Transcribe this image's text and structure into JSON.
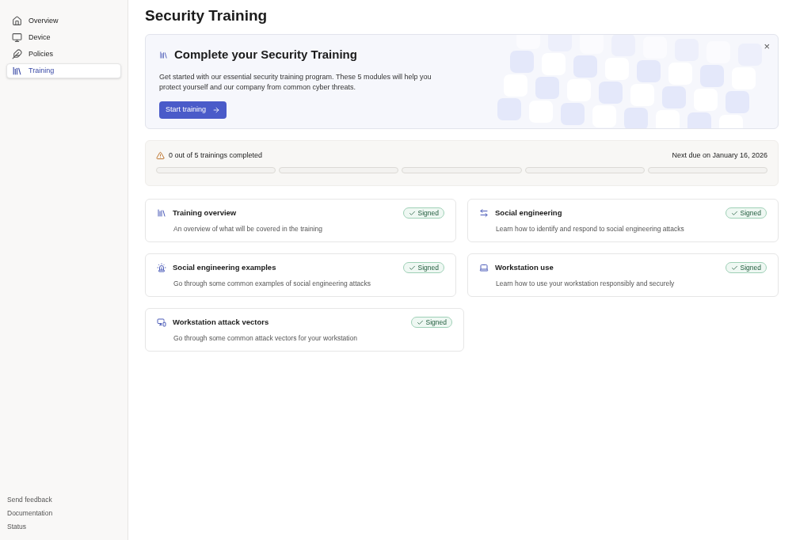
{
  "sidebar": {
    "items": [
      {
        "label": "Overview",
        "selected": false
      },
      {
        "label": "Device",
        "selected": false
      },
      {
        "label": "Policies",
        "selected": false
      },
      {
        "label": "Training",
        "selected": true
      }
    ],
    "footer_links": [
      "Send feedback",
      "Documentation",
      "Status"
    ]
  },
  "page_title": "Security Training",
  "banner": {
    "title": "Complete your Security Training",
    "text": "Get started with our essential security training program. These 5 modules will help you protect yourself and our company from common cyber threats.",
    "button": "Start training",
    "close": "×"
  },
  "progress": {
    "summary": "0 out of 5 trainings completed",
    "due": "Next due on January 16, 2026",
    "segments": [
      {
        "level": 0
      },
      {
        "level": 0
      },
      {
        "level": 0
      },
      {
        "level": 0
      },
      {
        "level": 0
      }
    ]
  },
  "modules": [
    {
      "title": "Training overview",
      "description": "An overview of what will be covered in the training",
      "badge": "Signed"
    },
    {
      "title": "Social engineering",
      "description": "Learn how to identify and respond to social engineering attacks",
      "badge": "Signed"
    },
    {
      "title": "Social engineering examples",
      "description": "Go through some common examples of social engineering attacks",
      "badge": "Signed"
    },
    {
      "title": "Workstation use",
      "description": "Learn how to use your workstation responsibly and securely",
      "badge": "Signed"
    },
    {
      "title": "Workstation attack vectors",
      "description": "Go through some common attack vectors for your workstation",
      "badge": "Signed"
    }
  ]
}
